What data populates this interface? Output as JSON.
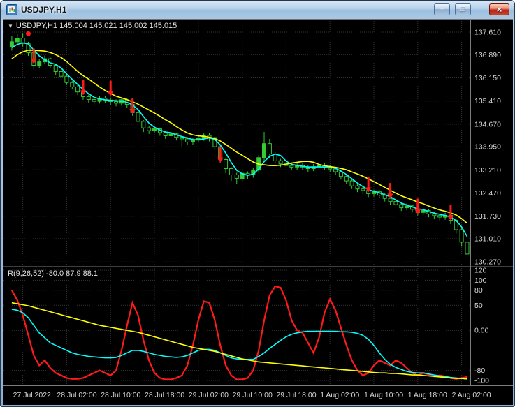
{
  "window": {
    "title": "USDJPY,H1",
    "controls": {
      "minimize": "–",
      "maximize": "□",
      "close": "×"
    }
  },
  "main_header": {
    "dropdown": "▼",
    "text": "USDJPY,H1 145.004 145.021 145.002 145.015"
  },
  "indicator_header": {
    "text": "R(9,26,52) -80.0 87.9 88.1"
  },
  "colors": {
    "background": "#000000",
    "grid": "#343434",
    "candle": "#33cc33",
    "bear_fill": "#000000",
    "arrow": "#ff1a1a",
    "axis_text": "#d6d6d6",
    "separator": "#7d7d7d",
    "ma_fast": "#00ffff",
    "ma_slow": "#ffff00",
    "ind_fast": "#ff1a1a",
    "ind_mid": "#00ffff",
    "ind_slow": "#ffff00"
  },
  "chart_data": [
    {
      "type": "candlestick",
      "symbol": "USDJPY",
      "timeframe": "H1",
      "ohlc_display": {
        "open": "145.004",
        "high": "145.021",
        "low": "145.002",
        "close": "145.015"
      },
      "ylim": [
        130.19,
        137.95
      ],
      "grid": true,
      "price_axis_labels": [
        "137.610",
        "136.890",
        "136.150",
        "135.410",
        "134.670",
        "133.950",
        "133.210",
        "132.470",
        "131.730",
        "131.010",
        "130.270"
      ],
      "time_axis": {
        "labels": [
          "27 Jul 2022",
          "28 Jul 02:00",
          "28 Jul 10:00",
          "28 Jul 18:00",
          "29 Jul 02:00",
          "29 Jul 10:00",
          "29 Jul 18:00",
          "1 Aug 02:00",
          "1 Aug 10:00",
          "1 Aug 18:00",
          "2 Aug 02:00"
        ],
        "bar_indices": [
          2,
          10,
          18,
          26,
          34,
          42,
          50,
          58,
          66,
          74,
          82
        ]
      },
      "ma_seed": [
        136.0,
        136.15,
        136.3,
        136.45,
        136.6,
        136.75,
        136.9,
        137.0,
        137.05,
        137.1
      ],
      "overlays": [
        {
          "name": "ma-fast-line",
          "color": "#00ffff",
          "period": 4
        },
        {
          "name": "ma-slow-line",
          "color": "#ffff00",
          "period": 10
        }
      ],
      "candles": [
        [
          137.15,
          137.48,
          137.02,
          137.3
        ],
        [
          137.3,
          137.55,
          137.22,
          137.42
        ],
        [
          137.42,
          137.58,
          137.15,
          137.25
        ],
        [
          137.25,
          137.3,
          136.85,
          136.95
        ],
        [
          136.95,
          137.0,
          136.42,
          136.55
        ],
        [
          136.55,
          136.74,
          136.47,
          136.66
        ],
        [
          136.66,
          136.86,
          136.58,
          136.76
        ],
        [
          136.76,
          136.8,
          136.45,
          136.55
        ],
        [
          136.55,
          136.6,
          136.25,
          136.35
        ],
        [
          136.35,
          136.42,
          136.1,
          136.2
        ],
        [
          136.2,
          136.25,
          135.92,
          136.0
        ],
        [
          136.0,
          136.06,
          135.78,
          135.86
        ],
        [
          135.86,
          135.92,
          135.6,
          135.7
        ],
        [
          135.7,
          135.76,
          135.45,
          135.55
        ],
        [
          135.55,
          135.62,
          135.36,
          135.46
        ],
        [
          135.46,
          135.54,
          135.3,
          135.4
        ],
        [
          135.4,
          135.58,
          135.33,
          135.5
        ],
        [
          135.5,
          135.57,
          135.35,
          135.44
        ],
        [
          135.44,
          135.52,
          135.28,
          135.39
        ],
        [
          135.39,
          135.46,
          135.24,
          135.34
        ],
        [
          135.34,
          135.52,
          135.26,
          135.45
        ],
        [
          135.45,
          135.5,
          135.2,
          135.3
        ],
        [
          135.3,
          135.34,
          134.94,
          135.04
        ],
        [
          135.04,
          135.08,
          134.64,
          134.76
        ],
        [
          134.76,
          134.8,
          134.42,
          134.55
        ],
        [
          134.55,
          134.62,
          134.36,
          134.46
        ],
        [
          134.46,
          134.6,
          134.38,
          134.52
        ],
        [
          134.52,
          134.56,
          134.3,
          134.4
        ],
        [
          134.4,
          134.46,
          134.2,
          134.3
        ],
        [
          134.3,
          134.44,
          134.22,
          134.36
        ],
        [
          134.36,
          134.4,
          134.15,
          134.25
        ],
        [
          134.25,
          134.3,
          133.96,
          134.2
        ],
        [
          134.2,
          134.26,
          134.0,
          134.1
        ],
        [
          134.1,
          134.24,
          134.02,
          134.16
        ],
        [
          134.16,
          134.3,
          134.08,
          134.22
        ],
        [
          134.22,
          134.4,
          134.14,
          134.31
        ],
        [
          134.31,
          134.38,
          134.12,
          134.24
        ],
        [
          134.24,
          134.28,
          133.85,
          133.95
        ],
        [
          133.95,
          134.0,
          133.42,
          133.54
        ],
        [
          133.54,
          133.6,
          133.1,
          133.25
        ],
        [
          133.25,
          133.3,
          132.86,
          133.05
        ],
        [
          133.05,
          133.12,
          132.76,
          132.94
        ],
        [
          132.94,
          133.18,
          132.84,
          133.1
        ],
        [
          133.1,
          133.16,
          132.92,
          133.05
        ],
        [
          133.05,
          133.28,
          132.96,
          133.2
        ],
        [
          133.2,
          133.68,
          133.12,
          133.6
        ],
        [
          133.6,
          134.42,
          133.5,
          134.05
        ],
        [
          134.05,
          134.2,
          133.58,
          133.72
        ],
        [
          133.72,
          133.78,
          133.4,
          133.5
        ],
        [
          133.5,
          133.56,
          133.3,
          133.4
        ],
        [
          133.4,
          133.46,
          133.25,
          133.35
        ],
        [
          133.35,
          133.42,
          133.2,
          133.3
        ],
        [
          133.3,
          133.44,
          133.22,
          133.36
        ],
        [
          133.36,
          133.42,
          133.2,
          133.3
        ],
        [
          133.3,
          133.36,
          133.15,
          133.25
        ],
        [
          133.25,
          133.4,
          133.17,
          133.31
        ],
        [
          133.31,
          133.46,
          133.24,
          133.36
        ],
        [
          133.36,
          133.42,
          133.2,
          133.3
        ],
        [
          133.3,
          133.36,
          133.14,
          133.24
        ],
        [
          133.24,
          133.3,
          133.05,
          133.15
        ],
        [
          133.15,
          133.2,
          132.9,
          133.0
        ],
        [
          133.0,
          133.05,
          132.76,
          132.86
        ],
        [
          132.86,
          132.92,
          132.6,
          132.7
        ],
        [
          132.7,
          132.76,
          132.5,
          132.6
        ],
        [
          132.6,
          132.66,
          132.44,
          132.55
        ],
        [
          132.55,
          132.6,
          132.34,
          132.45
        ],
        [
          132.45,
          132.58,
          132.36,
          132.51
        ],
        [
          132.51,
          132.56,
          132.3,
          132.4
        ],
        [
          132.4,
          132.46,
          132.2,
          132.3
        ],
        [
          132.3,
          132.36,
          132.1,
          132.2
        ],
        [
          132.2,
          132.26,
          132.0,
          132.1
        ],
        [
          132.1,
          132.16,
          131.9,
          132.0
        ],
        [
          132.0,
          132.14,
          131.92,
          132.06
        ],
        [
          132.06,
          132.1,
          131.85,
          131.95
        ],
        [
          131.95,
          132.0,
          131.75,
          131.85
        ],
        [
          131.85,
          131.98,
          131.77,
          131.91
        ],
        [
          131.91,
          131.95,
          131.7,
          131.8
        ],
        [
          131.8,
          131.86,
          131.65,
          131.75
        ],
        [
          131.75,
          131.8,
          131.6,
          131.7
        ],
        [
          131.7,
          131.84,
          131.62,
          131.76
        ],
        [
          131.76,
          131.8,
          131.48,
          131.6
        ],
        [
          131.6,
          131.64,
          131.18,
          131.3
        ],
        [
          131.3,
          131.36,
          130.76,
          130.9
        ],
        [
          130.9,
          130.96,
          130.36,
          130.52
        ]
      ],
      "signals": [
        {
          "bar": 4,
          "price": 136.75
        },
        {
          "bar": 13,
          "price": 135.75
        },
        {
          "bar": 18,
          "price": 135.72
        },
        {
          "bar": 22,
          "price": 135.15
        },
        {
          "bar": 38,
          "price": 133.6
        },
        {
          "bar": 65,
          "price": 132.65
        },
        {
          "bar": 69,
          "price": 132.45
        },
        {
          "bar": 74,
          "price": 131.95
        },
        {
          "bar": 80,
          "price": 131.75
        }
      ],
      "dots": [
        {
          "bar": 3,
          "price": 137.56
        }
      ]
    },
    {
      "type": "line",
      "name": "R(9,26,52)",
      "current_values": "-80.0 87.9 88.1",
      "ylim": [
        -110,
        125
      ],
      "grid": true,
      "levels": [
        {
          "label": "120",
          "value": 120
        },
        {
          "label": "100",
          "value": 100
        },
        {
          "label": "80",
          "value": 80
        },
        {
          "label": "50",
          "value": 50
        },
        {
          "label": "0.00",
          "value": 0
        },
        {
          "label": "-80",
          "value": -80
        },
        {
          "label": "-100",
          "value": -100
        }
      ],
      "series": [
        {
          "name": "fast",
          "color": "#ff1a1a",
          "values": [
            80,
            60,
            30,
            -10,
            -50,
            -70,
            -60,
            -75,
            -85,
            -90,
            -95,
            -97,
            -97,
            -95,
            -90,
            -85,
            -80,
            -85,
            -90,
            -80,
            -40,
            10,
            55,
            30,
            -20,
            -60,
            -85,
            -95,
            -98,
            -98,
            -95,
            -90,
            -70,
            -30,
            20,
            58,
            55,
            20,
            -30,
            -70,
            -90,
            -98,
            -98,
            -95,
            -80,
            -40,
            20,
            70,
            88,
            85,
            60,
            20,
            0,
            -5,
            -25,
            -45,
            -15,
            35,
            62,
            40,
            5,
            -30,
            -60,
            -80,
            -90,
            -85,
            -70,
            -60,
            -65,
            -70,
            -60,
            -65,
            -75,
            -85,
            -90,
            -85,
            -88,
            -92,
            -90,
            -92,
            -95,
            -97,
            -95,
            -93
          ]
        },
        {
          "name": "mid",
          "color": "#00ffff",
          "values": [
            42,
            40,
            35,
            25,
            10,
            -5,
            -15,
            -25,
            -30,
            -35,
            -40,
            -45,
            -48,
            -50,
            -52,
            -53,
            -54,
            -55,
            -55,
            -54,
            -50,
            -45,
            -40,
            -40,
            -42,
            -45,
            -48,
            -50,
            -52,
            -53,
            -54,
            -53,
            -50,
            -45,
            -40,
            -38,
            -38,
            -40,
            -45,
            -50,
            -55,
            -57,
            -58,
            -58,
            -58,
            -52,
            -45,
            -36,
            -28,
            -20,
            -13,
            -8,
            -5,
            -3,
            -2,
            -2,
            -2,
            -2,
            -2,
            -2,
            -3,
            -3,
            -4,
            -6,
            -10,
            -18,
            -30,
            -45,
            -58,
            -68,
            -74,
            -78,
            -82,
            -84,
            -85,
            -85,
            -87,
            -89,
            -91,
            -92,
            -94,
            -95,
            -96,
            -97
          ]
        },
        {
          "name": "slow",
          "color": "#ffff00",
          "values": [
            55,
            53,
            51,
            49,
            46,
            43,
            40,
            37,
            34,
            31,
            28,
            25,
            22,
            19,
            16,
            13,
            10,
            8,
            6,
            4,
            2,
            0,
            -2,
            -4,
            -7,
            -10,
            -13,
            -16,
            -19,
            -22,
            -25,
            -28,
            -31,
            -34,
            -36,
            -38,
            -40,
            -42,
            -45,
            -48,
            -51,
            -54,
            -57,
            -59,
            -61,
            -63,
            -64,
            -65,
            -66,
            -67,
            -68,
            -69,
            -70,
            -71,
            -72,
            -73,
            -74,
            -75,
            -76,
            -77,
            -78,
            -79,
            -80,
            -81,
            -82,
            -83,
            -84,
            -85,
            -85,
            -86,
            -86,
            -87,
            -88,
            -89,
            -89,
            -90,
            -91,
            -92,
            -93,
            -94,
            -95,
            -96,
            -96,
            -97
          ]
        }
      ]
    }
  ]
}
